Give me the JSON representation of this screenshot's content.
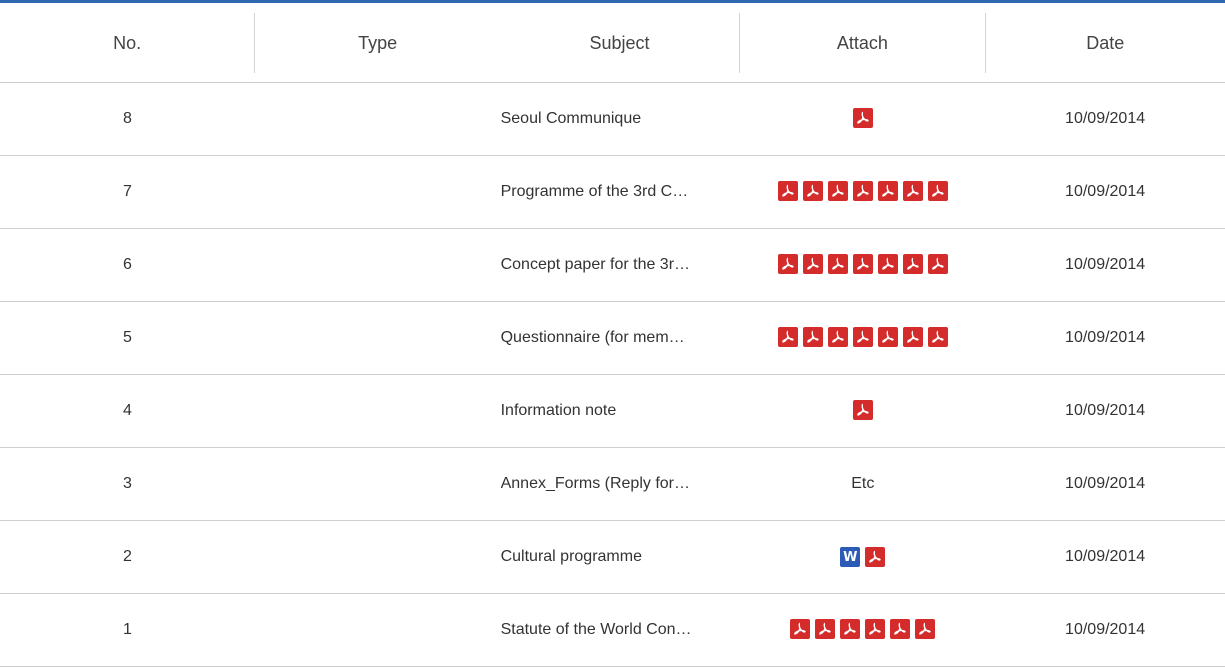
{
  "header": {
    "no": "No.",
    "type": "Type",
    "subject": "Subject",
    "attach": "Attach",
    "date": "Date"
  },
  "rows": [
    {
      "no": "8",
      "type": "",
      "subject": "Seoul Communique",
      "attach": [
        "pdf"
      ],
      "date": "10/09/2014"
    },
    {
      "no": "7",
      "type": "",
      "subject": "Programme of the 3rd C…",
      "attach": [
        "pdf",
        "pdf",
        "pdf",
        "pdf",
        "pdf",
        "pdf",
        "pdf"
      ],
      "date": "10/09/2014"
    },
    {
      "no": "6",
      "type": "",
      "subject": "Concept paper for the 3r…",
      "attach": [
        "pdf",
        "pdf",
        "pdf",
        "pdf",
        "pdf",
        "pdf",
        "pdf"
      ],
      "date": "10/09/2014"
    },
    {
      "no": "5",
      "type": "",
      "subject": "Questionnaire (for mem…",
      "attach": [
        "pdf",
        "pdf",
        "pdf",
        "pdf",
        "pdf",
        "pdf",
        "pdf"
      ],
      "date": "10/09/2014"
    },
    {
      "no": "4",
      "type": "",
      "subject": "Information note",
      "attach": [
        "pdf"
      ],
      "date": "10/09/2014"
    },
    {
      "no": "3",
      "type": "",
      "subject": "Annex_Forms (Reply for…",
      "attach_text": "Etc",
      "attach": [],
      "date": "10/09/2014"
    },
    {
      "no": "2",
      "type": "",
      "subject": "Cultural programme",
      "attach": [
        "doc",
        "pdf"
      ],
      "date": "10/09/2014"
    },
    {
      "no": "1",
      "type": "",
      "subject": "Statute of the World Con…",
      "attach": [
        "pdf",
        "pdf",
        "pdf",
        "pdf",
        "pdf",
        "pdf"
      ],
      "date": "10/09/2014"
    }
  ],
  "icons": {
    "pdf": "pdf-icon",
    "doc": "word-doc-icon",
    "doc_letter": "W"
  },
  "colors": {
    "accent_top_border": "#2f69b2",
    "pdf_red": "#d42b2b",
    "word_blue": "#2b5bb5"
  }
}
